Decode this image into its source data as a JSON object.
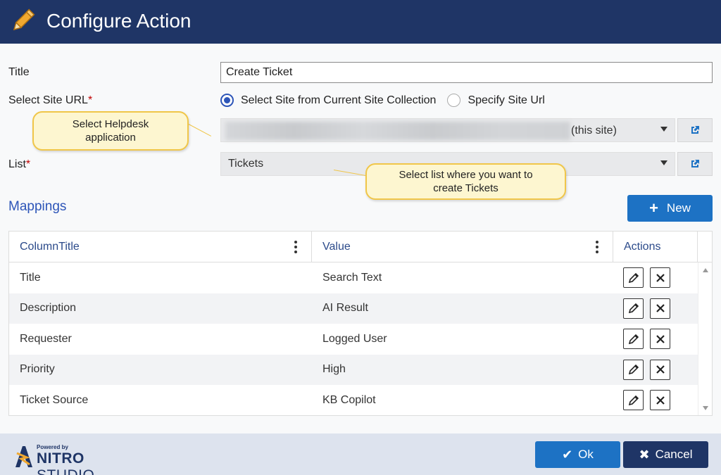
{
  "header": {
    "title": "Configure Action",
    "icon": "pencil-icon"
  },
  "form": {
    "title_label": "Title",
    "title_value": "Create Ticket",
    "site_url_label": "Select Site URL",
    "required_mark": "*",
    "radio_current": "Select Site from Current Site Collection",
    "radio_specify": "Specify Site Url",
    "site_selected_suffix": "(this site)",
    "list_label": "List",
    "list_value": "Tickets"
  },
  "callouts": {
    "site": "Select Helpdesk application",
    "list": "Select list where you want to create Tickets"
  },
  "mappings": {
    "title": "Mappings",
    "new_label": "New",
    "columns": [
      "ColumnTitle",
      "Value",
      "Actions"
    ],
    "rows": [
      {
        "column": "Title",
        "value": "Search Text"
      },
      {
        "column": "Description",
        "value": "AI Result"
      },
      {
        "column": "Requester",
        "value": "Logged User"
      },
      {
        "column": "Priority",
        "value": "High"
      },
      {
        "column": "Ticket Source",
        "value": "KB Copilot"
      }
    ]
  },
  "footer": {
    "logo_powered": "Powered by",
    "logo_nitro": "NITRO",
    "logo_studio": "STUDIO",
    "ok_label": "Ok",
    "cancel_label": "Cancel"
  },
  "colors": {
    "header_bg": "#1f3566",
    "accent": "#2d55b8",
    "primary_button": "#1d72c4",
    "callout_bg": "#fdf6d0",
    "callout_border": "#f0c649"
  }
}
